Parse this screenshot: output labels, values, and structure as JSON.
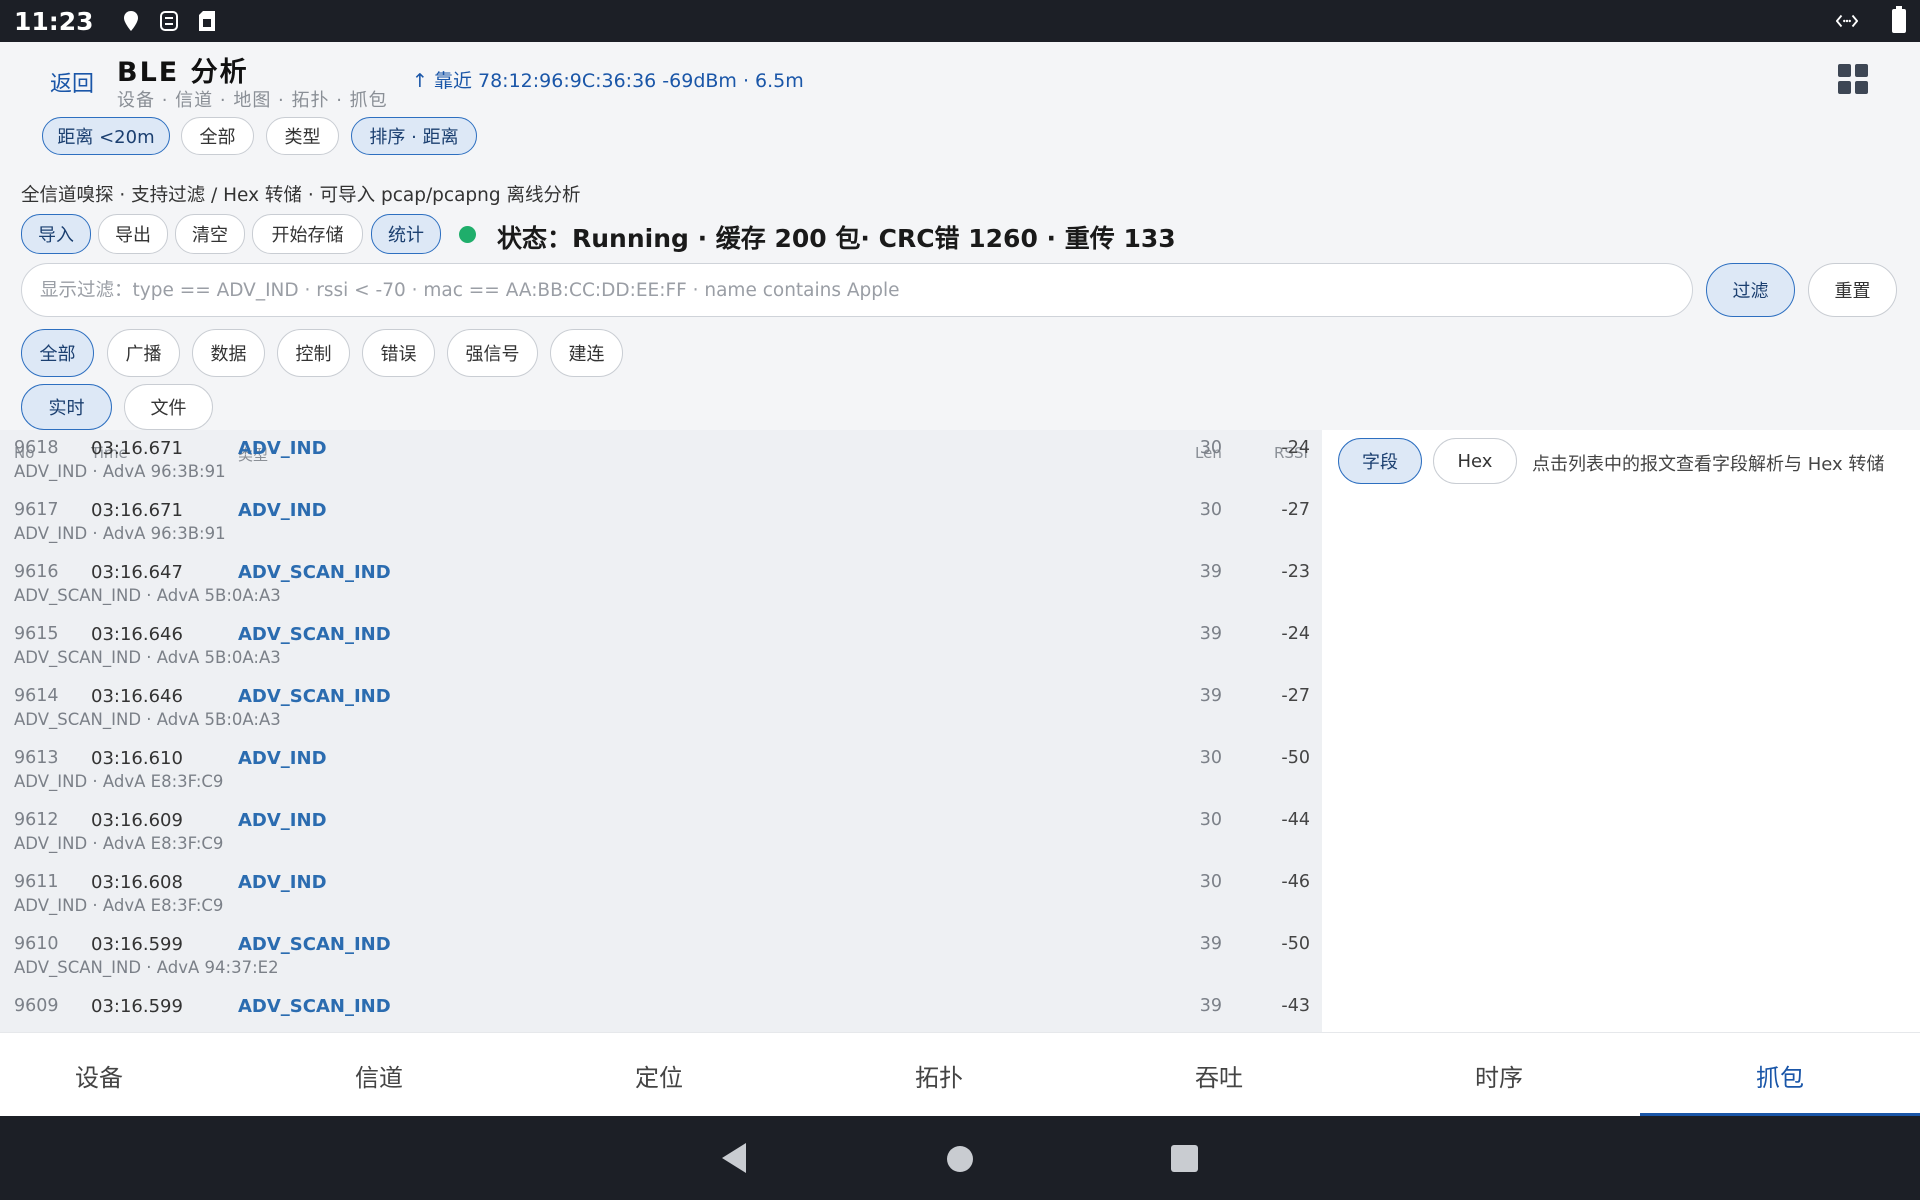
{
  "status_bar": {
    "time": "11:23",
    "icons": [
      "location-icon",
      "sync-icon",
      "sim-icon"
    ],
    "right_icons": [
      "data-transfer-icon",
      "battery-icon"
    ]
  },
  "header": {
    "back_label": "返回",
    "title": "BLE 分析",
    "subtitle": "设备 · 信道 · 地图 · 拓扑 · 抓包",
    "nearest": "↑ 靠近 78:12:96:9C:36:36 -69dBm · 6.5m",
    "chips": [
      {
        "label": "距离 <20m",
        "selected": true
      },
      {
        "label": "全部",
        "selected": false
      },
      {
        "label": "类型",
        "selected": false
      },
      {
        "label": "排序 · 距离",
        "selected": true
      }
    ]
  },
  "capture": {
    "description": "全信道嗅探 · 支持过滤 / Hex 转储 · 可导入 pcap/pcapng 离线分析",
    "actions": [
      {
        "label": "导入",
        "selected": true
      },
      {
        "label": "导出",
        "selected": false
      },
      {
        "label": "清空",
        "selected": false
      },
      {
        "label": "开始存储",
        "selected": false
      },
      {
        "label": "统计",
        "selected": true
      }
    ],
    "status_color": "#1fae6b",
    "status": "状态：Running · 缓存 200 包· CRC错 1260 · 重传 133",
    "filter_placeholder": "显示过滤：type == ADV_IND · rssi < -70 · mac == AA:BB:CC:DD:EE:FF · name contains Apple",
    "filter_button": "过滤",
    "reset_button": "重置",
    "categories": [
      {
        "label": "全部",
        "selected": true
      },
      {
        "label": "广播",
        "selected": false
      },
      {
        "label": "数据",
        "selected": false
      },
      {
        "label": "控制",
        "selected": false
      },
      {
        "label": "错误",
        "selected": false
      },
      {
        "label": "强信号",
        "selected": false
      },
      {
        "label": "建连",
        "selected": false
      }
    ],
    "sources": [
      {
        "label": "实时",
        "selected": true
      },
      {
        "label": "文件",
        "selected": false
      }
    ]
  },
  "table": {
    "columns": {
      "no": "No",
      "time": "Time",
      "type": "类型",
      "len": "Len",
      "rssi": "RSSI"
    },
    "rows": [
      {
        "no": "9618",
        "time": "03:16.671",
        "type": "ADV_IND",
        "len": "30",
        "rssi": "-24",
        "sub": "ADV_IND · AdvA 96:3B:91"
      },
      {
        "no": "9617",
        "time": "03:16.671",
        "type": "ADV_IND",
        "len": "30",
        "rssi": "-27",
        "sub": "ADV_IND · AdvA 96:3B:91"
      },
      {
        "no": "9616",
        "time": "03:16.647",
        "type": "ADV_SCAN_IND",
        "len": "39",
        "rssi": "-23",
        "sub": "ADV_SCAN_IND · AdvA 5B:0A:A3"
      },
      {
        "no": "9615",
        "time": "03:16.646",
        "type": "ADV_SCAN_IND",
        "len": "39",
        "rssi": "-24",
        "sub": "ADV_SCAN_IND · AdvA 5B:0A:A3"
      },
      {
        "no": "9614",
        "time": "03:16.646",
        "type": "ADV_SCAN_IND",
        "len": "39",
        "rssi": "-27",
        "sub": "ADV_SCAN_IND · AdvA 5B:0A:A3"
      },
      {
        "no": "9613",
        "time": "03:16.610",
        "type": "ADV_IND",
        "len": "30",
        "rssi": "-50",
        "sub": "ADV_IND · AdvA E8:3F:C9"
      },
      {
        "no": "9612",
        "time": "03:16.609",
        "type": "ADV_IND",
        "len": "30",
        "rssi": "-44",
        "sub": "ADV_IND · AdvA E8:3F:C9"
      },
      {
        "no": "9611",
        "time": "03:16.608",
        "type": "ADV_IND",
        "len": "30",
        "rssi": "-46",
        "sub": "ADV_IND · AdvA E8:3F:C9"
      },
      {
        "no": "9610",
        "time": "03:16.599",
        "type": "ADV_SCAN_IND",
        "len": "39",
        "rssi": "-50",
        "sub": "ADV_SCAN_IND · AdvA 94:37:E2"
      },
      {
        "no": "9609",
        "time": "03:16.599",
        "type": "ADV_SCAN_IND",
        "len": "39",
        "rssi": "-43",
        "sub": ""
      }
    ]
  },
  "detail": {
    "tabs": [
      {
        "label": "字段",
        "selected": true
      },
      {
        "label": "Hex",
        "selected": false
      }
    ],
    "hint": "点击列表中的报文查看字段解析与 Hex 转储"
  },
  "bottom_nav": {
    "tabs": [
      "设备",
      "信道",
      "定位",
      "拓扑",
      "吞吐",
      "时序",
      "抓包"
    ],
    "active": "抓包"
  }
}
